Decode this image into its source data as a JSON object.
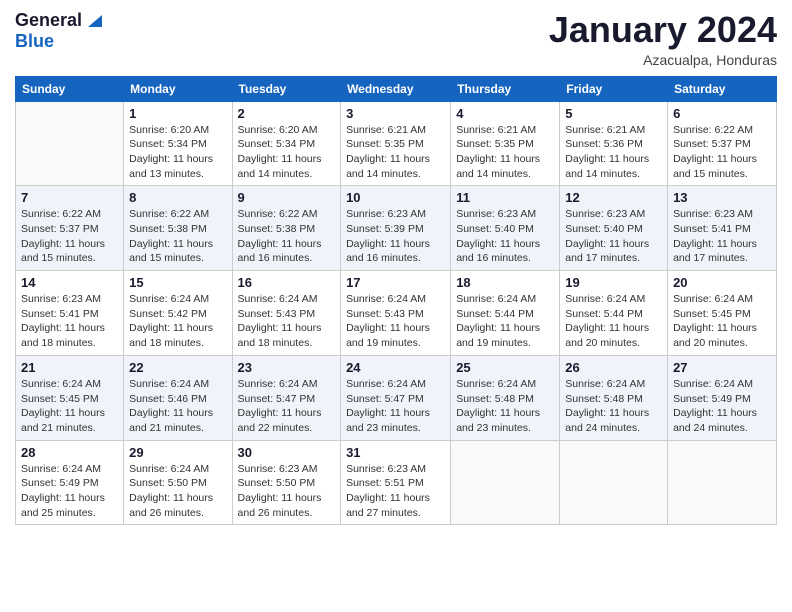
{
  "logo": {
    "general": "General",
    "blue": "Blue"
  },
  "title": "January 2024",
  "location": "Azacualpa, Honduras",
  "days_header": [
    "Sunday",
    "Monday",
    "Tuesday",
    "Wednesday",
    "Thursday",
    "Friday",
    "Saturday"
  ],
  "weeks": [
    [
      {
        "day": "",
        "info": ""
      },
      {
        "day": "1",
        "info": "Sunrise: 6:20 AM\nSunset: 5:34 PM\nDaylight: 11 hours\nand 13 minutes."
      },
      {
        "day": "2",
        "info": "Sunrise: 6:20 AM\nSunset: 5:34 PM\nDaylight: 11 hours\nand 14 minutes."
      },
      {
        "day": "3",
        "info": "Sunrise: 6:21 AM\nSunset: 5:35 PM\nDaylight: 11 hours\nand 14 minutes."
      },
      {
        "day": "4",
        "info": "Sunrise: 6:21 AM\nSunset: 5:35 PM\nDaylight: 11 hours\nand 14 minutes."
      },
      {
        "day": "5",
        "info": "Sunrise: 6:21 AM\nSunset: 5:36 PM\nDaylight: 11 hours\nand 14 minutes."
      },
      {
        "day": "6",
        "info": "Sunrise: 6:22 AM\nSunset: 5:37 PM\nDaylight: 11 hours\nand 15 minutes."
      }
    ],
    [
      {
        "day": "7",
        "info": "Sunrise: 6:22 AM\nSunset: 5:37 PM\nDaylight: 11 hours\nand 15 minutes."
      },
      {
        "day": "8",
        "info": "Sunrise: 6:22 AM\nSunset: 5:38 PM\nDaylight: 11 hours\nand 15 minutes."
      },
      {
        "day": "9",
        "info": "Sunrise: 6:22 AM\nSunset: 5:38 PM\nDaylight: 11 hours\nand 16 minutes."
      },
      {
        "day": "10",
        "info": "Sunrise: 6:23 AM\nSunset: 5:39 PM\nDaylight: 11 hours\nand 16 minutes."
      },
      {
        "day": "11",
        "info": "Sunrise: 6:23 AM\nSunset: 5:40 PM\nDaylight: 11 hours\nand 16 minutes."
      },
      {
        "day": "12",
        "info": "Sunrise: 6:23 AM\nSunset: 5:40 PM\nDaylight: 11 hours\nand 17 minutes."
      },
      {
        "day": "13",
        "info": "Sunrise: 6:23 AM\nSunset: 5:41 PM\nDaylight: 11 hours\nand 17 minutes."
      }
    ],
    [
      {
        "day": "14",
        "info": "Sunrise: 6:23 AM\nSunset: 5:41 PM\nDaylight: 11 hours\nand 18 minutes."
      },
      {
        "day": "15",
        "info": "Sunrise: 6:24 AM\nSunset: 5:42 PM\nDaylight: 11 hours\nand 18 minutes."
      },
      {
        "day": "16",
        "info": "Sunrise: 6:24 AM\nSunset: 5:43 PM\nDaylight: 11 hours\nand 18 minutes."
      },
      {
        "day": "17",
        "info": "Sunrise: 6:24 AM\nSunset: 5:43 PM\nDaylight: 11 hours\nand 19 minutes."
      },
      {
        "day": "18",
        "info": "Sunrise: 6:24 AM\nSunset: 5:44 PM\nDaylight: 11 hours\nand 19 minutes."
      },
      {
        "day": "19",
        "info": "Sunrise: 6:24 AM\nSunset: 5:44 PM\nDaylight: 11 hours\nand 20 minutes."
      },
      {
        "day": "20",
        "info": "Sunrise: 6:24 AM\nSunset: 5:45 PM\nDaylight: 11 hours\nand 20 minutes."
      }
    ],
    [
      {
        "day": "21",
        "info": "Sunrise: 6:24 AM\nSunset: 5:45 PM\nDaylight: 11 hours\nand 21 minutes."
      },
      {
        "day": "22",
        "info": "Sunrise: 6:24 AM\nSunset: 5:46 PM\nDaylight: 11 hours\nand 21 minutes."
      },
      {
        "day": "23",
        "info": "Sunrise: 6:24 AM\nSunset: 5:47 PM\nDaylight: 11 hours\nand 22 minutes."
      },
      {
        "day": "24",
        "info": "Sunrise: 6:24 AM\nSunset: 5:47 PM\nDaylight: 11 hours\nand 23 minutes."
      },
      {
        "day": "25",
        "info": "Sunrise: 6:24 AM\nSunset: 5:48 PM\nDaylight: 11 hours\nand 23 minutes."
      },
      {
        "day": "26",
        "info": "Sunrise: 6:24 AM\nSunset: 5:48 PM\nDaylight: 11 hours\nand 24 minutes."
      },
      {
        "day": "27",
        "info": "Sunrise: 6:24 AM\nSunset: 5:49 PM\nDaylight: 11 hours\nand 24 minutes."
      }
    ],
    [
      {
        "day": "28",
        "info": "Sunrise: 6:24 AM\nSunset: 5:49 PM\nDaylight: 11 hours\nand 25 minutes."
      },
      {
        "day": "29",
        "info": "Sunrise: 6:24 AM\nSunset: 5:50 PM\nDaylight: 11 hours\nand 26 minutes."
      },
      {
        "day": "30",
        "info": "Sunrise: 6:23 AM\nSunset: 5:50 PM\nDaylight: 11 hours\nand 26 minutes."
      },
      {
        "day": "31",
        "info": "Sunrise: 6:23 AM\nSunset: 5:51 PM\nDaylight: 11 hours\nand 27 minutes."
      },
      {
        "day": "",
        "info": ""
      },
      {
        "day": "",
        "info": ""
      },
      {
        "day": "",
        "info": ""
      }
    ]
  ]
}
